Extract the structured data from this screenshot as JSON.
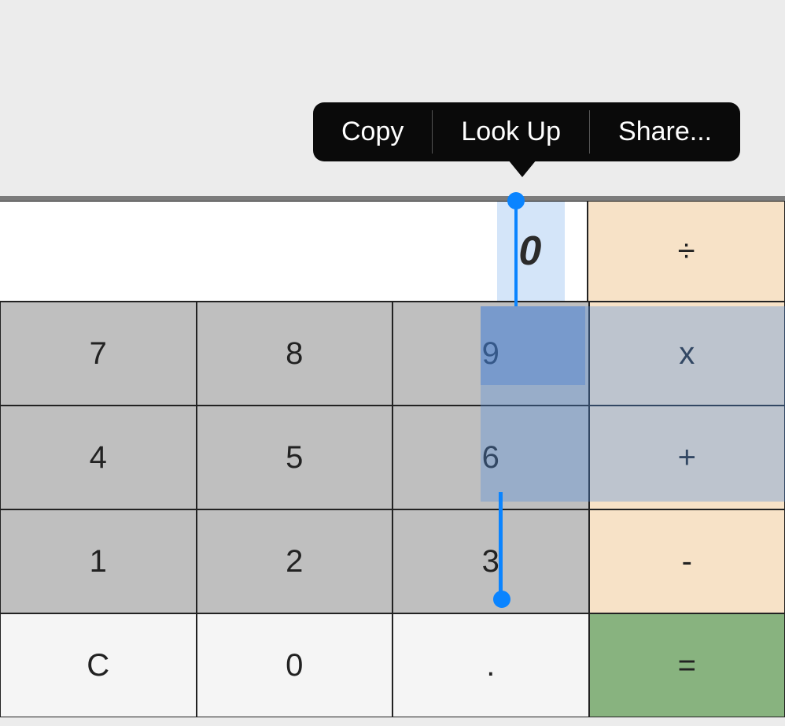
{
  "context_menu": {
    "copy": "Copy",
    "lookup": "Look Up",
    "share": "Share..."
  },
  "display": {
    "value": "0"
  },
  "operators": {
    "divide": "÷",
    "multiply": "x",
    "plus": "+",
    "minus": "-",
    "equals": "="
  },
  "keys": {
    "k7": "7",
    "k8": "8",
    "k9": "9",
    "k4": "4",
    "k5": "5",
    "k6": "6",
    "k1": "1",
    "k2": "2",
    "k3": "3",
    "clear": "C",
    "k0": "0",
    "dot": "."
  }
}
